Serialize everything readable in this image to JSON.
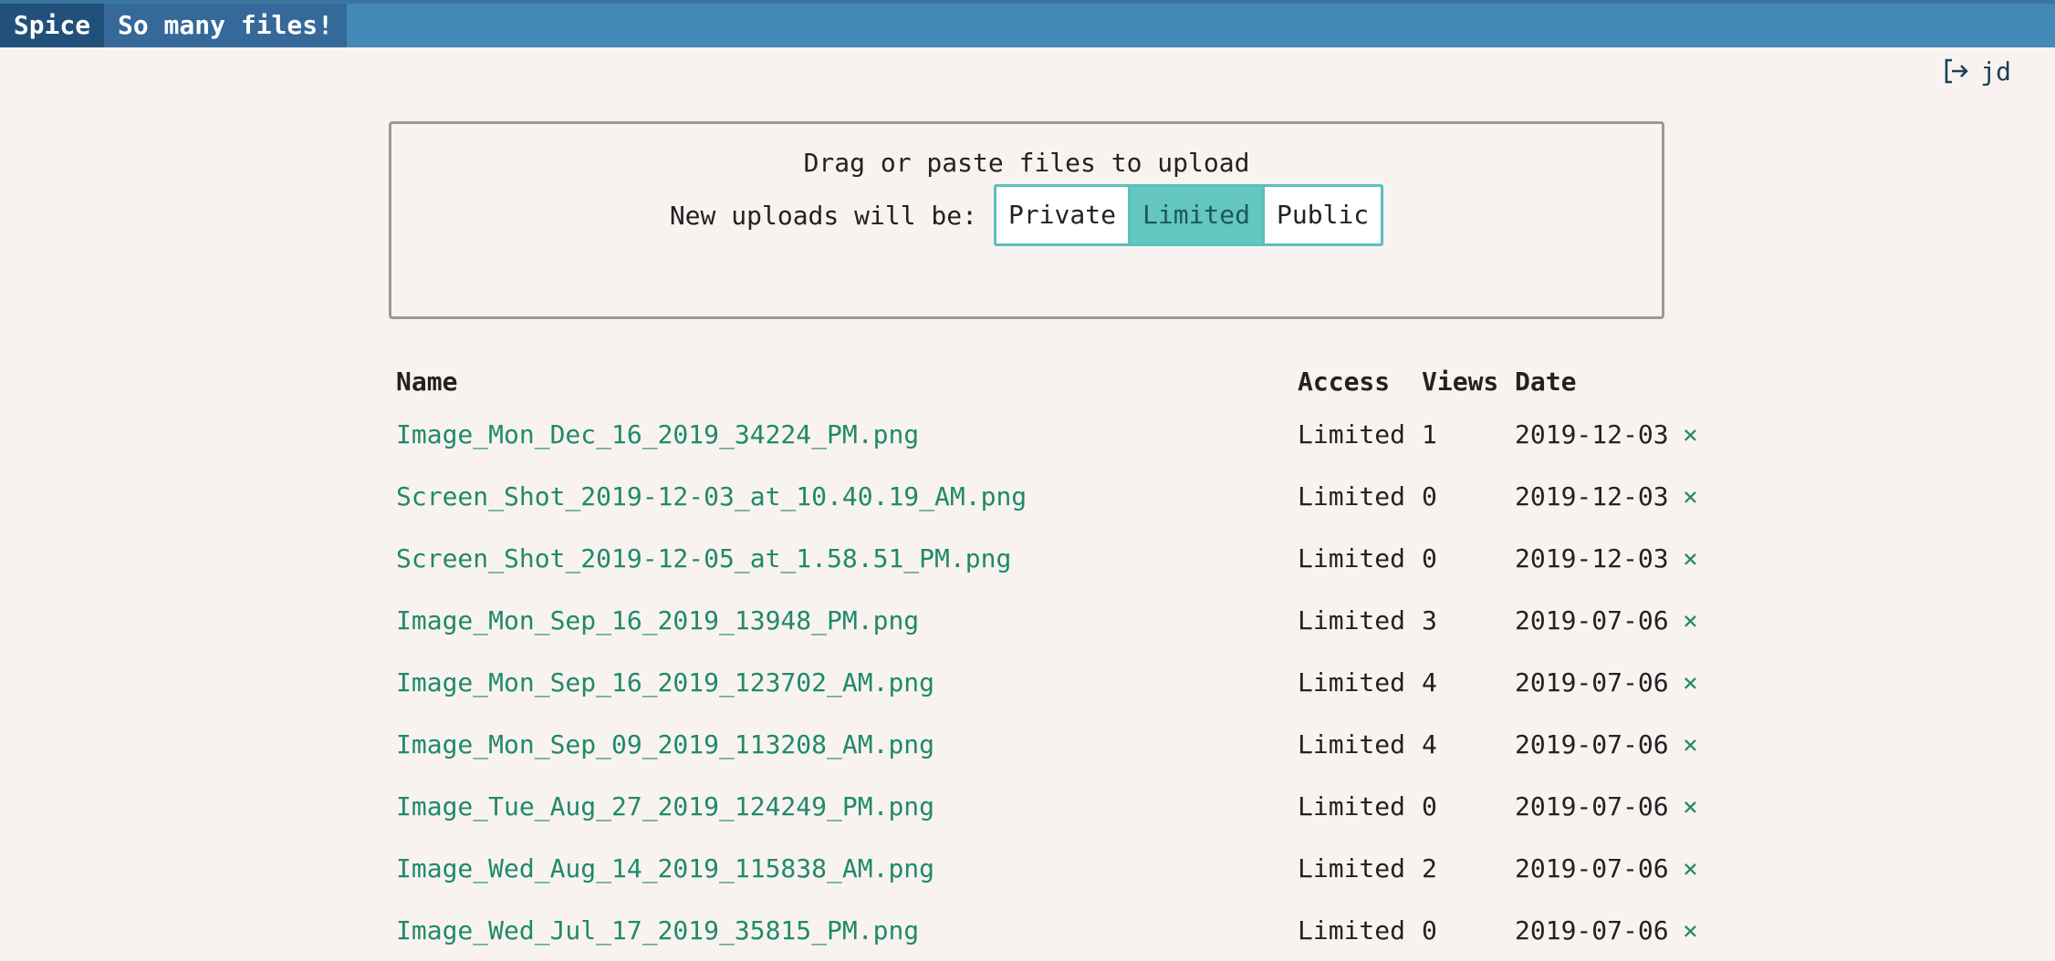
{
  "header": {
    "brand": "Spice",
    "title": "So many files!"
  },
  "user": {
    "logout_icon": "logout-icon",
    "name": "jd"
  },
  "upload": {
    "hint": "Drag or paste files to upload",
    "access_label": "New uploads will be:",
    "options": [
      "Private",
      "Limited",
      "Public"
    ],
    "selected": "Limited"
  },
  "table": {
    "headers": {
      "name": "Name",
      "access": "Access",
      "views": "Views",
      "date": "Date"
    },
    "delete_glyph": "×",
    "rows": [
      {
        "name": "Image_Mon_Dec_16_2019_34224_PM.png",
        "access": "Limited",
        "views": "1",
        "date": "2019-12-03"
      },
      {
        "name": "Screen_Shot_2019-12-03_at_10.40.19_AM.png",
        "access": "Limited",
        "views": "0",
        "date": "2019-12-03"
      },
      {
        "name": "Screen_Shot_2019-12-05_at_1.58.51_PM.png",
        "access": "Limited",
        "views": "0",
        "date": "2019-12-03"
      },
      {
        "name": "Image_Mon_Sep_16_2019_13948_PM.png",
        "access": "Limited",
        "views": "3",
        "date": "2019-07-06"
      },
      {
        "name": "Image_Mon_Sep_16_2019_123702_AM.png",
        "access": "Limited",
        "views": "4",
        "date": "2019-07-06"
      },
      {
        "name": "Image_Mon_Sep_09_2019_113208_AM.png",
        "access": "Limited",
        "views": "4",
        "date": "2019-07-06"
      },
      {
        "name": "Image_Tue_Aug_27_2019_124249_PM.png",
        "access": "Limited",
        "views": "0",
        "date": "2019-07-06"
      },
      {
        "name": "Image_Wed_Aug_14_2019_115838_AM.png",
        "access": "Limited",
        "views": "2",
        "date": "2019-07-06"
      },
      {
        "name": "Image_Wed_Jul_17_2019_35815_PM.png",
        "access": "Limited",
        "views": "0",
        "date": "2019-07-06"
      }
    ]
  },
  "colors": {
    "topbar": "#4389b6",
    "brand_bg": "#21507a",
    "title_bg": "#34699a",
    "link": "#1f8a68",
    "accent": "#63c6c1",
    "background": "#f8f3f0"
  }
}
